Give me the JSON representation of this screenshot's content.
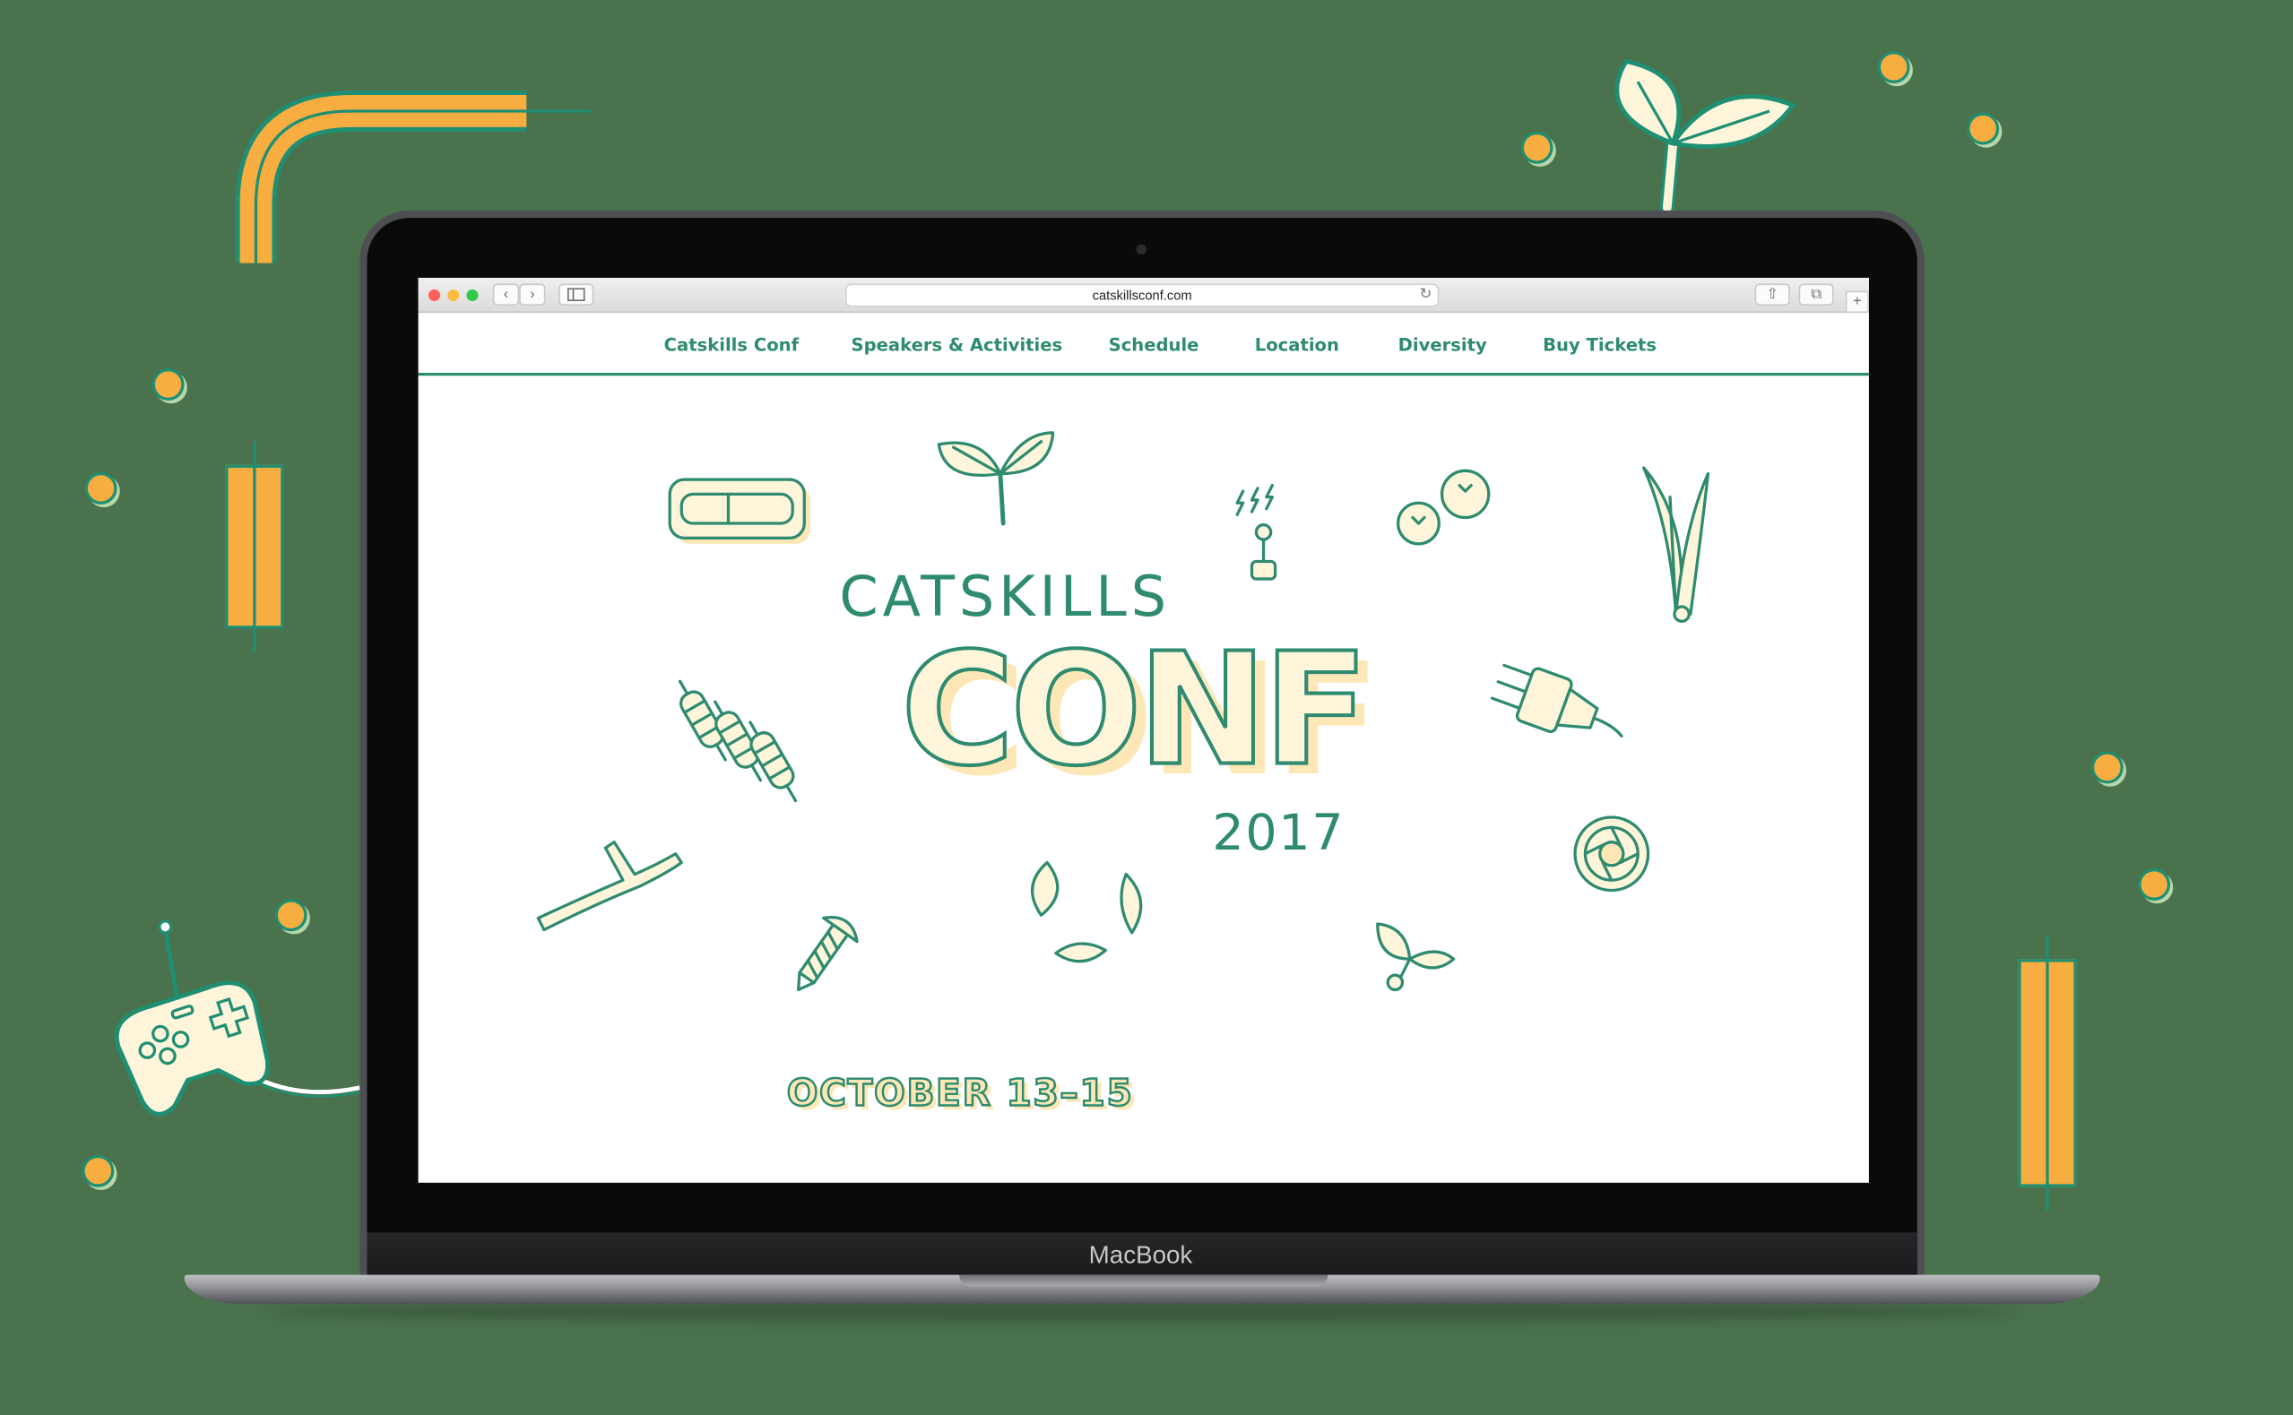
{
  "browser": {
    "url": "catskillsconf.com",
    "traffic_lights": [
      "#fc605b",
      "#fdbc40",
      "#34c84a"
    ]
  },
  "nav": {
    "items": [
      "Catskills Conf",
      "Speakers & Activities",
      "Schedule",
      "Location",
      "Diversity",
      "Buy Tickets"
    ]
  },
  "hero": {
    "line1": "CATSKILLS",
    "line2": "CONF",
    "year": "2017",
    "date": "OCTOBER 13–15"
  },
  "device": {
    "label": "MacBook"
  },
  "icons": [
    "harmonica-icon",
    "sprout-icon",
    "joystick-icon",
    "blueberries-icon",
    "grass-icon",
    "resistors-icon",
    "plug-icon",
    "twig-icon",
    "screw-icon",
    "leaves-icon",
    "seedling-icon",
    "camera-lens-icon",
    "game-controller-icon"
  ],
  "colors": {
    "background": "#4a724d",
    "brand_green": "#2e8b6f",
    "accent_orange": "#f7ad3f",
    "cream": "#fde7b6"
  }
}
